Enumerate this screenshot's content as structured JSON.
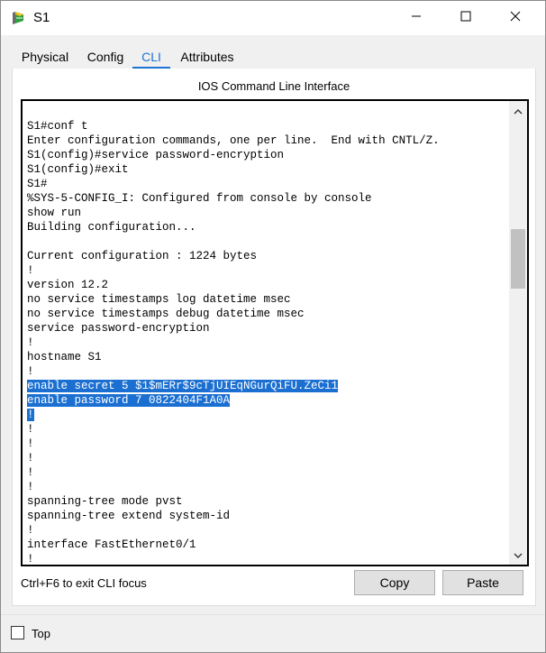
{
  "window": {
    "title": "S1",
    "icon": "router-icon",
    "controls": {
      "minimize": "minimize-icon",
      "maximize": "maximize-icon",
      "close": "close-icon"
    }
  },
  "tabs": [
    {
      "label": "Physical",
      "active": false
    },
    {
      "label": "Config",
      "active": false
    },
    {
      "label": "CLI",
      "active": true
    },
    {
      "label": "Attributes",
      "active": false
    }
  ],
  "panel": {
    "title": "IOS Command Line Interface"
  },
  "terminal": {
    "lines": [
      "S1#conf t",
      "Enter configuration commands, one per line.  End with CNTL/Z.",
      "S1(config)#service password-encryption",
      "S1(config)#exit",
      "S1#",
      "%SYS-5-CONFIG_I: Configured from console by console",
      "show run",
      "Building configuration...",
      "",
      "Current configuration : 1224 bytes",
      "!",
      "version 12.2",
      "no service timestamps log datetime msec",
      "no service timestamps debug datetime msec",
      "service password-encryption",
      "!",
      "hostname S1",
      "!",
      "enable secret 5 $1$mERr$9cTjUIEqNGurQiFU.ZeCi1",
      "enable password 7 0822404F1A0A",
      "!",
      "!",
      "!",
      "!",
      "!",
      "!",
      "spanning-tree mode pvst",
      "spanning-tree extend system-id",
      "!",
      "interface FastEthernet0/1",
      "!"
    ],
    "selected_lines": [
      18,
      19,
      20
    ],
    "selection_color": "#1a6fd1"
  },
  "footer": {
    "hint": "Ctrl+F6 to exit CLI focus",
    "copy_label": "Copy",
    "paste_label": "Paste"
  },
  "top_checkbox": {
    "label": "Top",
    "checked": false
  },
  "colors": {
    "accent": "#1e73d2",
    "background": "#f0f0f0"
  }
}
